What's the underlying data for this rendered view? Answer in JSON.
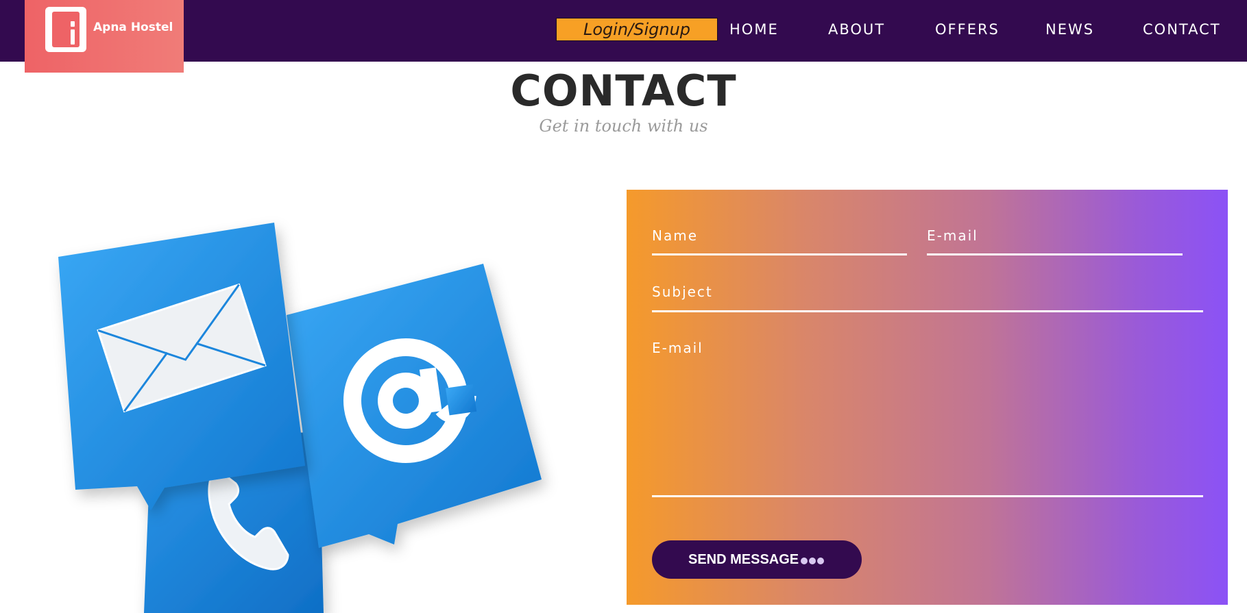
{
  "header": {
    "logo_text": "Apna Hostel",
    "login_label": "Login/Signup",
    "nav": [
      {
        "label": "HOME"
      },
      {
        "label": "ABOUT"
      },
      {
        "label": "OFFERS"
      },
      {
        "label": "NEWS"
      },
      {
        "label": "CONTACT"
      }
    ]
  },
  "page": {
    "title": "CONTACT",
    "subtitle": "Get in touch with us"
  },
  "illustration": {
    "icons": [
      "envelope-icon",
      "at-sign-icon",
      "phone-icon"
    ]
  },
  "form": {
    "name_placeholder": "Name",
    "email_placeholder": "E-mail",
    "subject_placeholder": "Subject",
    "message_placeholder": "E-mail",
    "send_label": "SEND MESSAGE"
  },
  "colors": {
    "header_bg": "#330a4f",
    "logo_bg": "#ee6366",
    "login_bg": "#f7a025",
    "gradient_start": "#f59a2b",
    "gradient_end": "#8b52f6",
    "icon_blue": "#1b86dc"
  }
}
